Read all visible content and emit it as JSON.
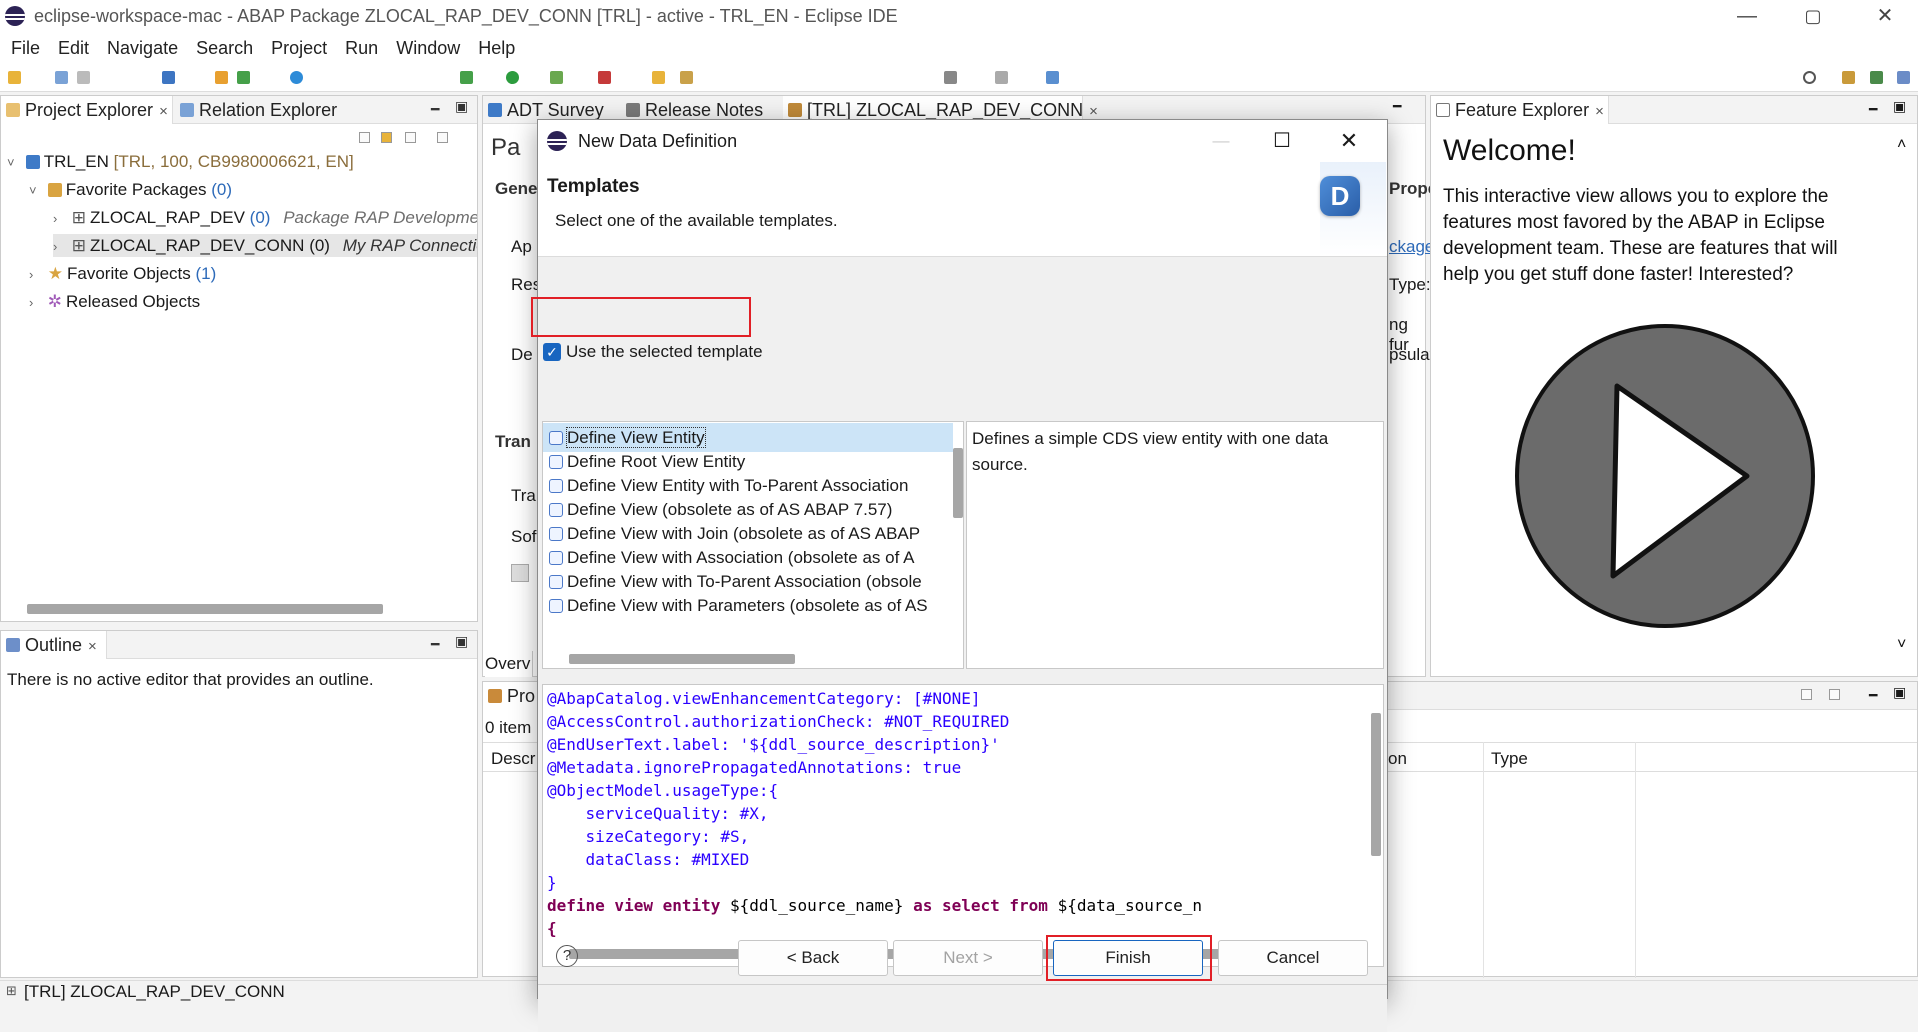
{
  "window": {
    "title": "eclipse-workspace-mac - ABAP Package ZLOCAL_RAP_DEV_CONN [TRL] - active - TRL_EN - Eclipse IDE",
    "minimize": "—",
    "maximize": "▢",
    "close": "✕"
  },
  "menu": [
    "File",
    "Edit",
    "Navigate",
    "Search",
    "Project",
    "Run",
    "Window",
    "Help"
  ],
  "left_panel": {
    "tabs": [
      {
        "label": "Project Explorer",
        "close": "×"
      },
      {
        "label": "Relation Explorer"
      }
    ],
    "tree": {
      "project": {
        "name": "TRL_EN",
        "meta": "[TRL, 100, CB9980006621, EN]"
      },
      "favorite_packages": {
        "label": "Favorite Packages",
        "count": "(0)"
      },
      "packages": [
        {
          "name": "ZLOCAL_RAP_DEV",
          "count": "(0)",
          "desc": "Package RAP Development"
        },
        {
          "name": "ZLOCAL_RAP_DEV_CONN",
          "count": "(0)",
          "desc": "My RAP Connection"
        }
      ],
      "favorite_objects": {
        "label": "Favorite Objects",
        "count": "(1)"
      },
      "released_objects": {
        "label": "Released Objects"
      }
    }
  },
  "outline": {
    "tab": "Outline",
    "close": "×",
    "message": "There is no active editor that provides an outline."
  },
  "editor": {
    "tabs": [
      {
        "label": "ADT Survey"
      },
      {
        "label": "Release Notes"
      },
      {
        "label": "[TRL] ZLOCAL_RAP_DEV_CONN",
        "close": "×"
      }
    ],
    "bg_text": {
      "pa": "Pa",
      "gene": "Gene",
      "ap": "Ap",
      "res": "Res",
      "de": "De",
      "tran": "Tran",
      "tra": "Tra",
      "sof": "Sof",
      "overv": "Overv",
      "pro": "Pro",
      "items": "0 item",
      "descr": "Descr",
      "prope": "Prope",
      "ckage": "ckage",
      "type_colon": "Type:",
      "ng_fur": "ng fur",
      "psulat": "psulat",
      "on": "on",
      "type": "Type"
    }
  },
  "feature_explorer": {
    "tab": "Feature Explorer",
    "close": "×",
    "title": "Welcome!",
    "body": "This interactive view allows you to explore the features most favored by the ABAP in Eclipse development team. These are features that will help you get stuff done faster! Interested?"
  },
  "status_bar": {
    "text": "[TRL] ZLOCAL_RAP_DEV_CONN"
  },
  "dialog": {
    "title": "New Data Definition",
    "header_title": "Templates",
    "header_subtitle": "Select one of the available templates.",
    "header_logo": "D",
    "use_template_label": "Use the selected template",
    "use_template_checked": true,
    "templates": [
      "Define View Entity",
      "Define Root View Entity",
      "Define View Entity with To-Parent Association",
      "Define View (obsolete as of AS ABAP 7.57)",
      "Define View with Join (obsolete as of AS ABAP",
      "Define View with Association (obsolete as of A",
      "Define View with To-Parent Association (obsole",
      "Define View with Parameters (obsolete as of AS"
    ],
    "selected_template": "Define View Entity",
    "description": "Defines a simple CDS view entity with one data source.",
    "code": [
      {
        "segments": [
          {
            "t": "@AbapCatalog.viewEnhancementCategory: [#NONE]",
            "c": "anv"
          }
        ]
      },
      {
        "segments": [
          {
            "t": "@AccessControl.authorizationCheck: #NOT_REQUIRED",
            "c": "anv"
          }
        ]
      },
      {
        "segments": [
          {
            "t": "@EndUserText.label: '${ddl_source_description}'",
            "c": "anv"
          }
        ]
      },
      {
        "segments": [
          {
            "t": "@Metadata.ignorePropagatedAnnotations: true",
            "c": "anv"
          }
        ]
      },
      {
        "segments": [
          {
            "t": "@ObjectModel.usageType:{",
            "c": "anv"
          }
        ]
      },
      {
        "segments": [
          {
            "t": "    serviceQuality: #X,",
            "c": "anv"
          }
        ]
      },
      {
        "segments": [
          {
            "t": "    sizeCategory: #S,",
            "c": "anv"
          }
        ]
      },
      {
        "segments": [
          {
            "t": "    dataClass: #MIXED",
            "c": "anv"
          }
        ]
      },
      {
        "segments": [
          {
            "t": "}",
            "c": "anv"
          }
        ]
      },
      {
        "segments": [
          {
            "t": "define view entity ",
            "c": "kw"
          },
          {
            "t": "${ddl_source_name} ",
            "c": "plain"
          },
          {
            "t": "as select from ",
            "c": "kw"
          },
          {
            "t": "${data_source_n",
            "c": "plain"
          }
        ]
      },
      {
        "segments": [
          {
            "t": "{",
            "c": "kw"
          }
        ]
      }
    ],
    "help": "?",
    "buttons": {
      "back": "< Back",
      "next": "Next >",
      "finish": "Finish",
      "cancel": "Cancel"
    }
  }
}
